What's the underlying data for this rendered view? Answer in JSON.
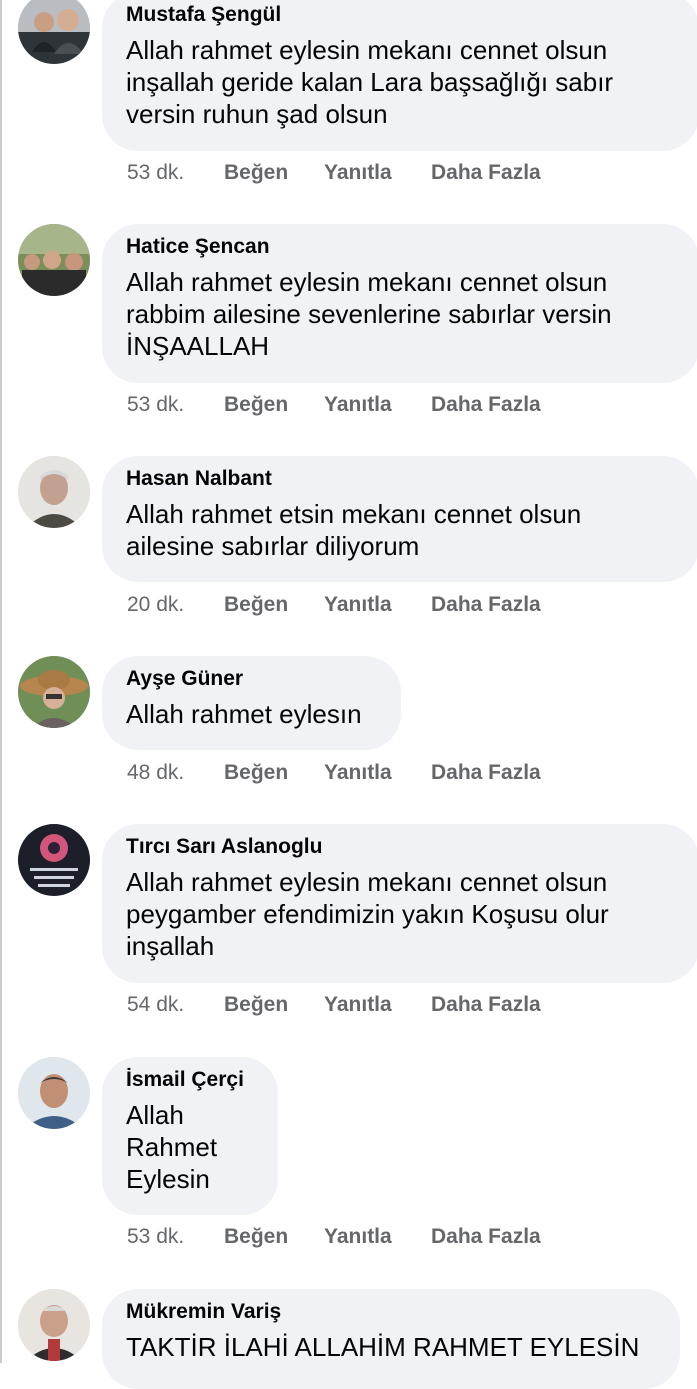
{
  "comments": [
    {
      "author": "Mustafa Şengül",
      "text": "Allah rahmet eylesin mekanı cennet olsun\ninşallah geride kalan Lara başsağlığı sabır\nversin ruhun şad olsun",
      "time": "53 dk."
    },
    {
      "author": "Hatice Şencan",
      "text": "Allah rahmet eylesin mekanı cennet olsun\nrabbim ailesine sevenlerine sabırlar versin\nİNŞAALLAH",
      "time": "53 dk."
    },
    {
      "author": "Hasan Nalbant",
      "text": "Allah rahmet etsin mekanı cennet olsun\nailesine sabırlar diliyorum",
      "time": "20 dk."
    },
    {
      "author": "Ayşe Güner",
      "text": "Allah rahmet eylesın",
      "time": "48 dk."
    },
    {
      "author": "Tırcı Sarı Aslanoglu",
      "text": "Allah rahmet eylesin mekanı cennet olsun\npeygamber efendimizin yakın Koşusu olur\ninşallah",
      "time": "54 dk."
    },
    {
      "author": "İsmail Çerçi",
      "text": "Allah\nRahmet\nEylesin",
      "time": "53 dk."
    },
    {
      "author": "Mükremin Variş",
      "text": "TAKTİR İLAHİ ALLAHİM RAHMET EYLESİN",
      "time": ""
    }
  ],
  "actions": {
    "like": "Beğen",
    "reply": "Yanıtla",
    "more": "Daha Fazla"
  },
  "colors": {
    "bubble": "#f0f2f5",
    "meta": "#65676b",
    "text": "#050505"
  }
}
